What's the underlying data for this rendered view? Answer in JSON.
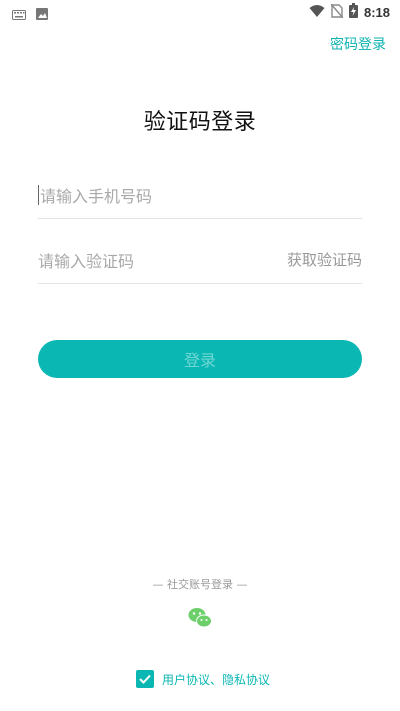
{
  "status_bar": {
    "time": "8:18",
    "icons": [
      "keyboard-icon",
      "image-icon",
      "wifi-icon",
      "no-sim-icon",
      "battery-charging-icon"
    ]
  },
  "header": {
    "password_login_link": "密码登录"
  },
  "main": {
    "title": "验证码登录",
    "phone_placeholder": "请输入手机号码",
    "code_placeholder": "请输入验证码",
    "get_code_label": "获取验证码",
    "login_button": "登录"
  },
  "social": {
    "label": "— 社交账号登录 —",
    "icon": "wechat-icon"
  },
  "agreement": {
    "checked": true,
    "text": "用户协议、隐私协议"
  },
  "colors": {
    "accent": "#0ab7b3",
    "button_text": "#6fd7d3",
    "wechat_green": "#6ccf6a"
  }
}
